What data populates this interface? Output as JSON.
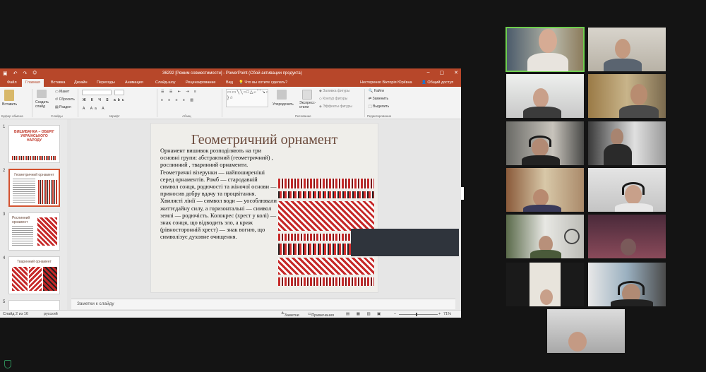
{
  "window": {
    "title": "36292 [Режим совместимости] - PowerPoint (Сбой активации продукта)",
    "quick_access": [
      "↶",
      "↷",
      "⛭"
    ],
    "controls": [
      "–",
      "▢",
      "✕"
    ]
  },
  "tabs": [
    "Файл",
    "Главная",
    "Вставка",
    "Дизайн",
    "Переходы",
    "Анимация",
    "Слайд-шоу",
    "Рецензирование",
    "Вид"
  ],
  "active_tab": "Главная",
  "tell_me": "Что вы хотите сделать?",
  "user_name": "Нестеренко Вікторія Юріївна",
  "share": "Общий доступ",
  "ribbon": {
    "paste": "Вставить",
    "clipboard_group": "Буфер обмена",
    "layout": "Макет",
    "reset": "Сбросить",
    "new_slide": "Создать слайд",
    "section": "Раздел",
    "slides_group": "Слайды",
    "font_group": "Шрифт",
    "paragraph_group": "Абзац",
    "arrange": "Упорядочить",
    "quick_styles": "Экспресс-стили",
    "shape_fill": "Заливка фигуры",
    "shape_outline": "Контур фигуры",
    "shape_effects": "Эффекты фигуры",
    "drawing_group": "Рисование",
    "find": "Найти",
    "replace": "Заменить",
    "select": "Выделить",
    "editing_group": "Редактирование"
  },
  "thumbnails": [
    {
      "num": "1",
      "title": "ВИШИВАНКА – ОБЕРІГ УКРАЇНСЬКОГО НАРОДУ"
    },
    {
      "num": "2",
      "title": "Геометричний орнамент"
    },
    {
      "num": "3",
      "title": "Рослинний орнамент"
    },
    {
      "num": "4",
      "title": "Тваринний орнамент"
    },
    {
      "num": "5",
      "title": ""
    }
  ],
  "slide": {
    "title": "Геометричний орнамент",
    "body": "Орнамент вишивок розподіляють на три основні групи: абстрактний (геометричний) , рослинний , тваринний орнаменти. Геометричні візерунки — найпоширеніші серед орнаментів. Ромб — стародавній символ сонця, родючості та жіночої основи — приносив добру вдачу та процвітання. Хвилясті лінії — символ води — уособлювали життєдайну силу, а горизонтальні — символ землі — родючість. Колокрес (хрест у колі) — знак сонця, що відводить зло, а криж (рівносторонній хрест) — знак вогню, що символізує духовне очищення."
  },
  "notes_placeholder": "Заметки к слайду",
  "status": {
    "slide_of": "Слайд 2 из 16",
    "language": "русский",
    "notes": "Заметки",
    "comments": "Примечания",
    "zoom": "71%"
  },
  "colors": {
    "ppt_accent": "#b7472a",
    "active_speaker": "#6fcf4e"
  }
}
